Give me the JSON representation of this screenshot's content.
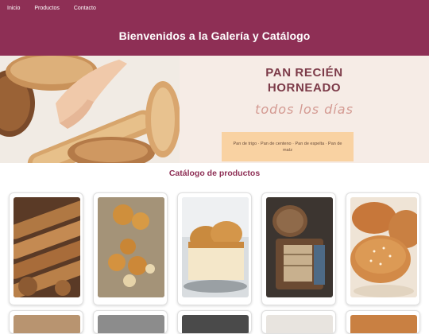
{
  "nav": {
    "items": [
      {
        "label": "Inicio"
      },
      {
        "label": "Productos"
      },
      {
        "label": "Contacto"
      }
    ]
  },
  "header": {
    "title": "Bienvenidos a la Galería y Catálogo"
  },
  "hero": {
    "title_line1": "PAN RECIÉN",
    "title_line2": "HORNEADO",
    "subtitle": "todos los días",
    "box_text": "Pan de trigo · Pan de centeno · Pan de espelta · Pan de maíz",
    "colors": {
      "title": "#7c3a48",
      "subtitle": "#d49a92",
      "box": "#f9d2a2",
      "background": "#f6ece6"
    }
  },
  "catalog": {
    "title": "Catálogo de productos",
    "products": [
      {
        "icon": "baguettes-photo"
      },
      {
        "icon": "bread-rolls-photo"
      },
      {
        "icon": "brioche-loaf-photo"
      },
      {
        "icon": "rustic-loaf-photo"
      },
      {
        "icon": "sesame-buns-photo"
      }
    ]
  },
  "colors": {
    "brand": "#8e2f55"
  }
}
